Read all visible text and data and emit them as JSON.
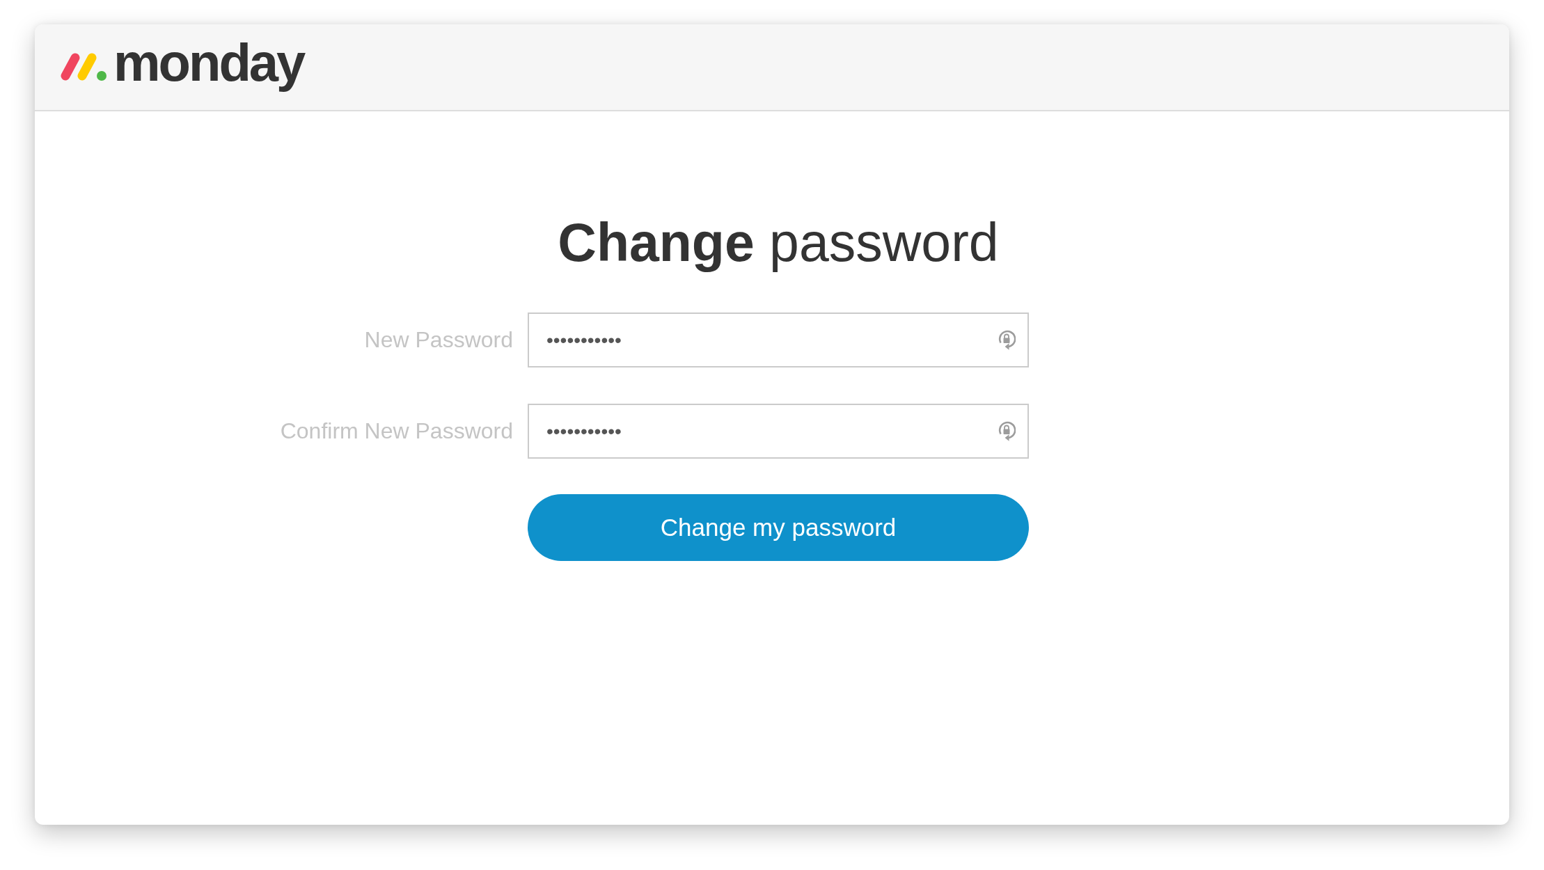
{
  "header": {
    "logo_text": "monday"
  },
  "heading": "**Change** password",
  "fields": [
    {
      "label": "New Password",
      "value": "•••••••••••"
    },
    {
      "label": "Confirm New Password",
      "value": "•••••••••••"
    }
  ],
  "submit_button": "Change my password"
}
